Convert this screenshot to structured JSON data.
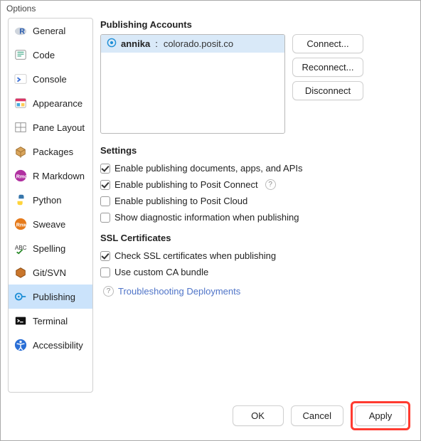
{
  "window_title": "Options",
  "sidebar": {
    "items": [
      {
        "id": "general",
        "label": "General"
      },
      {
        "id": "code",
        "label": "Code"
      },
      {
        "id": "console",
        "label": "Console"
      },
      {
        "id": "appearance",
        "label": "Appearance"
      },
      {
        "id": "pane-layout",
        "label": "Pane Layout"
      },
      {
        "id": "packages",
        "label": "Packages"
      },
      {
        "id": "r-markdown",
        "label": "R Markdown"
      },
      {
        "id": "python",
        "label": "Python"
      },
      {
        "id": "sweave",
        "label": "Sweave"
      },
      {
        "id": "spelling",
        "label": "Spelling"
      },
      {
        "id": "git-svn",
        "label": "Git/SVN"
      },
      {
        "id": "publishing",
        "label": "Publishing",
        "selected": true
      },
      {
        "id": "terminal",
        "label": "Terminal"
      },
      {
        "id": "accessibility",
        "label": "Accessibility"
      }
    ]
  },
  "main": {
    "section_accounts": "Publishing Accounts",
    "accounts": [
      {
        "user": "annika",
        "server": "colorado.posit.co"
      }
    ],
    "buttons": {
      "connect": "Connect...",
      "reconnect": "Reconnect...",
      "disconnect": "Disconnect"
    },
    "section_settings": "Settings",
    "settings": {
      "enable_publishing": {
        "label": "Enable publishing documents, apps, and APIs",
        "checked": true
      },
      "enable_posit_connect": {
        "label": "Enable publishing to Posit Connect",
        "checked": true,
        "help": true
      },
      "enable_posit_cloud": {
        "label": "Enable publishing to Posit Cloud",
        "checked": false
      },
      "show_diagnostic": {
        "label": "Show diagnostic information when publishing",
        "checked": false
      }
    },
    "section_ssl": "SSL Certificates",
    "ssl": {
      "check_ssl": {
        "label": "Check SSL certificates when publishing",
        "checked": true
      },
      "custom_ca": {
        "label": "Use custom CA bundle",
        "checked": false
      }
    },
    "troubleshoot_link": "Troubleshooting Deployments"
  },
  "footer": {
    "ok": "OK",
    "cancel": "Cancel",
    "apply": "Apply"
  }
}
